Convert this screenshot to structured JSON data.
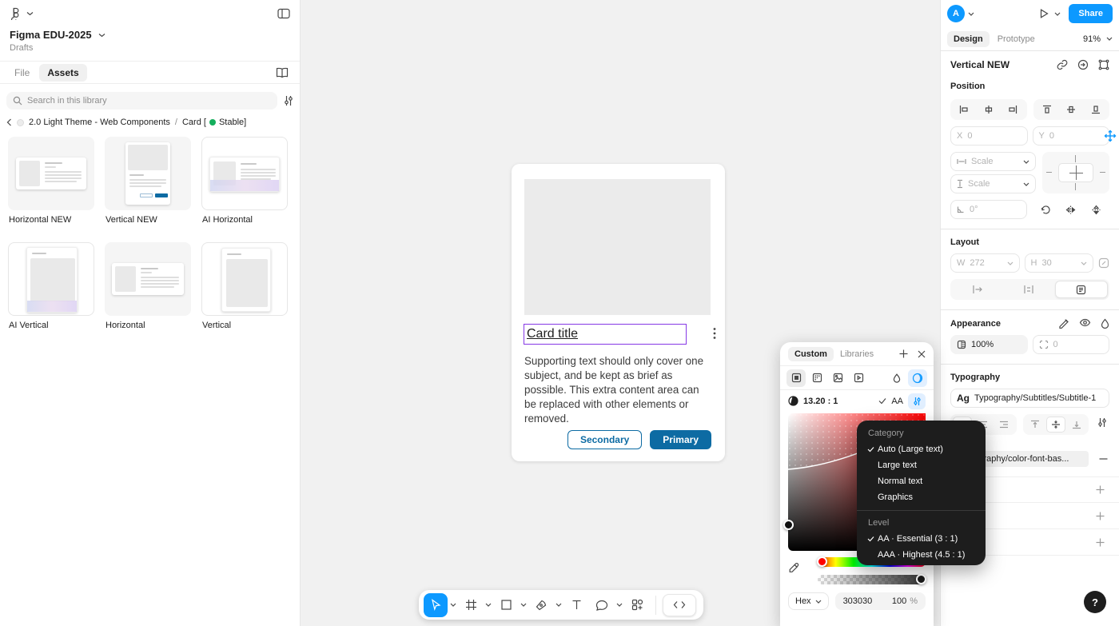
{
  "app": {
    "file_name": "Figma EDU-2025",
    "project": "Drafts",
    "avatar_initial": "A",
    "share_label": "Share",
    "zoom_level": "91%",
    "tabs": {
      "design": "Design",
      "prototype": "Prototype"
    },
    "panel_tabs": {
      "file": "File",
      "assets": "Assets"
    },
    "dev_mode_label": "</>",
    "help_label": "?"
  },
  "library": {
    "search_placeholder": "Search in this library",
    "breadcrumb": {
      "library": "2.0 Light Theme - Web Components",
      "separator": "/",
      "page_prefix": "Card [",
      "status": "Stable]"
    },
    "items": [
      {
        "label": "Horizontal NEW"
      },
      {
        "label": "Vertical NEW"
      },
      {
        "label": "AI Horizontal"
      },
      {
        "label": "AI Vertical"
      },
      {
        "label": "Horizontal"
      },
      {
        "label": "Vertical"
      }
    ]
  },
  "canvas_card": {
    "title": "Card title",
    "body": "Supporting text should only cover one subject, and be kept as brief as possible. This extra content area can be replaced with other elements or removed.",
    "secondary_label": "Secondary",
    "primary_label": "Primary"
  },
  "inspector": {
    "selection_name": "Vertical NEW",
    "position": {
      "label": "Position",
      "x_label": "X",
      "x_value": "0",
      "y_label": "Y",
      "y_value": "0",
      "h_constraint": "Scale",
      "v_constraint": "Scale",
      "rotation": "0°"
    },
    "layout": {
      "label": "Layout",
      "w_label": "W",
      "w_value": "272",
      "h_label": "H",
      "h_value": "30"
    },
    "appearance": {
      "label": "Appearance",
      "opacity": "100%",
      "radius": "0"
    },
    "typography": {
      "label": "Typography",
      "style_preview": "Ag",
      "style_name": "Typography/Subtitles/Subtitle-1",
      "color_style": "l/Typography/color-font-bas..."
    }
  },
  "color_picker": {
    "tab_custom": "Custom",
    "tab_libraries": "Libraries",
    "contrast_ratio": "13.20 : 1",
    "contrast_badge": "AA",
    "hex_label": "Hex",
    "hex_value": "303030",
    "alpha_value": "100",
    "alpha_unit": "%"
  },
  "contrast_menu": {
    "category_label": "Category",
    "items": [
      {
        "label": "Auto (Large text)"
      },
      {
        "label": "Large text"
      },
      {
        "label": "Normal text"
      },
      {
        "label": "Graphics"
      }
    ],
    "level_label": "Level",
    "levels": [
      {
        "label": "AA · Essential (3 : 1)"
      },
      {
        "label": "AAA · Highest (4.5 : 1)"
      }
    ]
  },
  "colors": {
    "accent_blue": "#0d99ff",
    "button_blue": "#0d6ba3",
    "component_purple": "#8638e5",
    "stable_green": "#14ae5c",
    "menu_dark": "#1d1d1d",
    "canvas_gray": "#f1f1f1",
    "picked_hex": "#303030"
  }
}
